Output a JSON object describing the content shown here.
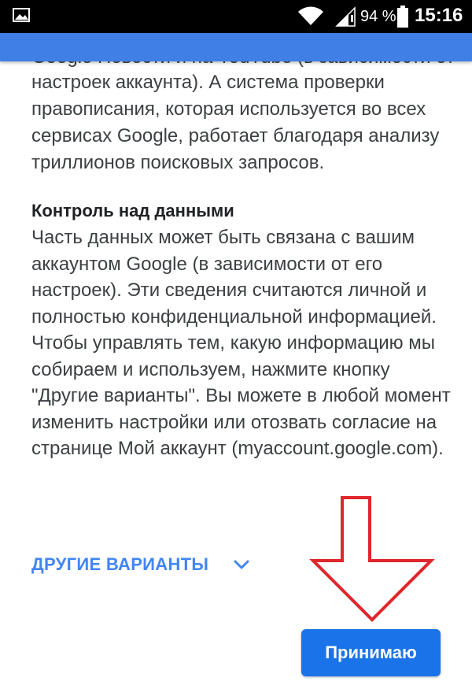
{
  "status_bar": {
    "battery_percent": "94 %",
    "time": "15:16",
    "icons": [
      "gallery-icon",
      "wifi-icon",
      "signal-icon",
      "battery-icon"
    ]
  },
  "content": {
    "cut_line": "Google Новости и на YouTube (в зависимости от",
    "paragraph1": "настроек аккаунта). А система проверки правописания, которая используется во всех сервисах Google, работает благодаря анализу триллионов поисковых запросов.",
    "section_heading": "Контроль над данными",
    "paragraph2": "Часть данных может быть связана с вашим аккаунтом Google (в зависимости от его настроек). Эти сведения считаются личной и полностью конфиденциальной информацией. Чтобы управлять тем, какую информацию мы собираем и используем, нажмите кнопку \"Другие варианты\". Вы можете в любой момент изменить настройки или отозвать согласие на странице Мой аккаунт (myaccount.google.com)."
  },
  "actions": {
    "other_options_label": "ДРУГИЕ ВАРИАНТЫ",
    "accept_label": "Принимаю"
  },
  "colors": {
    "header_blue": "#3f7fe6",
    "link_blue": "#4285f4",
    "button_blue": "#1a73e8",
    "annotation_red": "#e0262b"
  }
}
